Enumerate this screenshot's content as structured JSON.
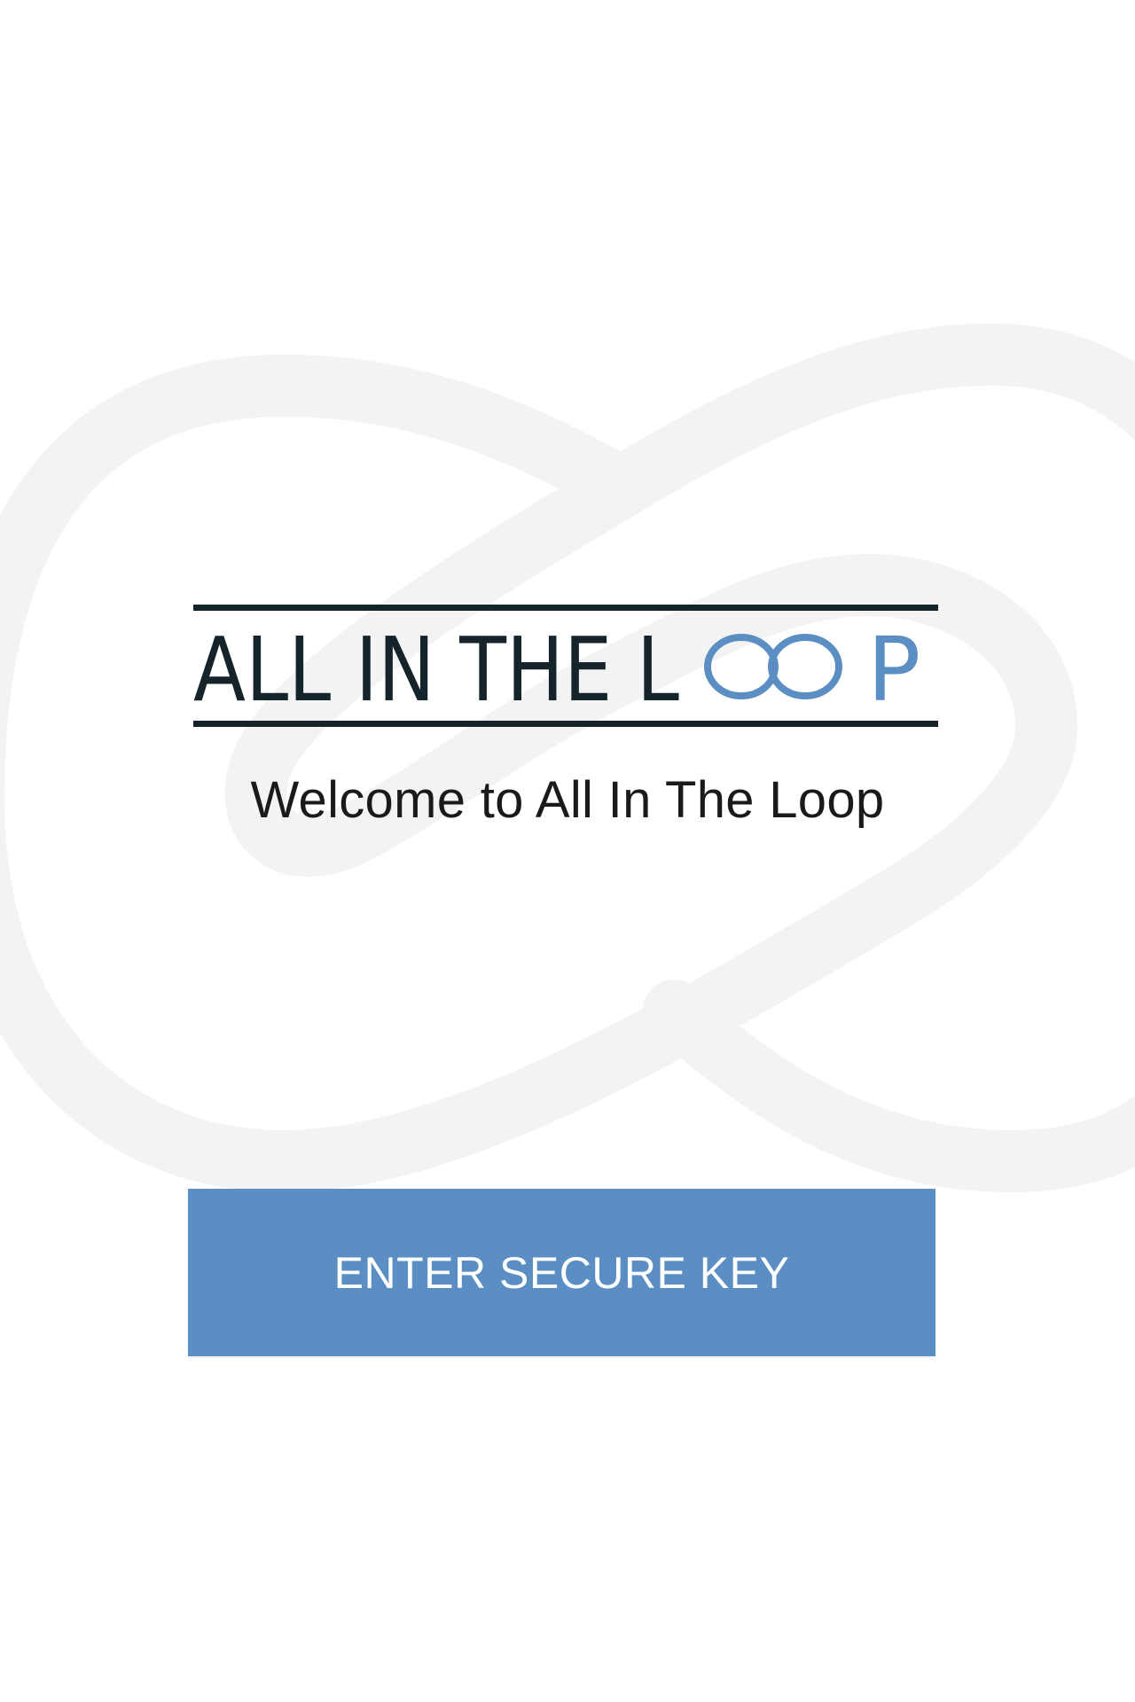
{
  "logo": {
    "text_dark": "ALL IN THE L",
    "text_accent": "P",
    "icon": "infinity-loop-icon",
    "dark_color": "#15232b",
    "accent_color": "#5b8fc4"
  },
  "welcome": {
    "text": "Welcome to All In The Loop"
  },
  "cta": {
    "label": "ENTER SECURE KEY",
    "color": "#5b8fc4"
  },
  "background": {
    "watermark_icon": "infinity-watermark-icon",
    "color": "#ffffff",
    "watermark_color": "#f3f3f3"
  }
}
